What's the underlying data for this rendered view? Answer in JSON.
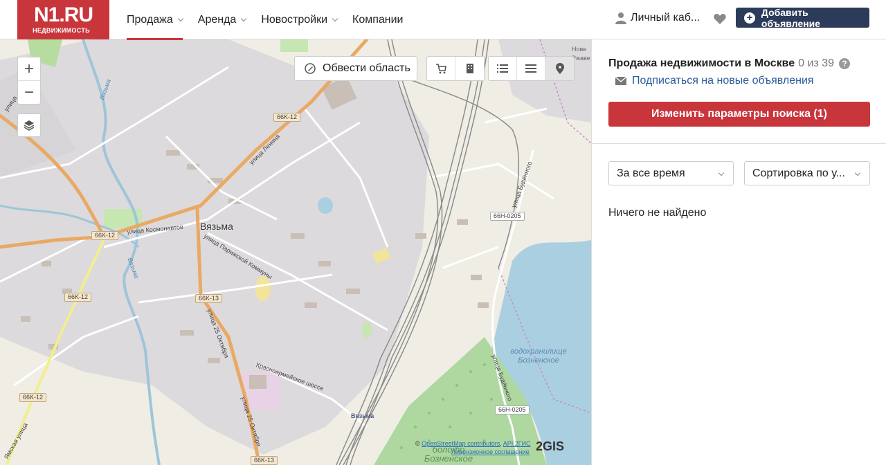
{
  "header": {
    "logo_main": "N1.RU",
    "logo_sub": "НЕДВИЖИМОСТЬ",
    "nav": [
      {
        "label": "Продажа",
        "active": true,
        "dropdown": true
      },
      {
        "label": "Аренда",
        "active": false,
        "dropdown": true
      },
      {
        "label": "Новостройки",
        "active": false,
        "dropdown": true
      },
      {
        "label": "Компании",
        "active": false,
        "dropdown": false
      }
    ],
    "cabinet_label": "Личный каб...",
    "add_button_label": "Добавить объявление",
    "colors": {
      "brand": "#c8363c",
      "add_button": "#2d3b5a"
    }
  },
  "map": {
    "area_button_label": "Обвести область",
    "zoom_in": "+",
    "zoom_out": "−",
    "icons": [
      "layers-icon",
      "cart-icon",
      "building-icon",
      "list-icon",
      "menu-icon",
      "map-pin-icon"
    ],
    "city_label": "Вязьма",
    "station_label": "Вязьма",
    "road_signs": [
      "66K-12",
      "66K-12",
      "66K-12",
      "66K-12",
      "66K-13",
      "66K-13",
      "66H-0205",
      "66H-0205"
    ],
    "street_labels": [
      "улица Ленина",
      "улица Космонавтов",
      "улица Парижской Коммуны",
      "улица 25 Октября",
      "улица 25 Октября",
      "Красноармейское шоссе",
      "улица Будённого",
      "улица Будённого",
      "Ямская улица",
      "улица",
      "Вязьма",
      "Вязьма"
    ],
    "water_label": "водохранилище Бозненское",
    "swamp_label": "болото Бозненское",
    "corner_text": "Нове Ржаве",
    "attribution": {
      "prefix": "©",
      "osm": "OpenStreetMap contributors",
      "api": "API 2ГИС",
      "license": "Лицензионное соглашение",
      "gis_logo": "2GIS"
    }
  },
  "panel": {
    "title": "Продажа недвижимости в Москве",
    "count": "0 из 39",
    "help": "?",
    "subscribe_label": "Подписаться на новые объявления",
    "change_button_label": "Изменить параметры поиска (1)",
    "period_select": "За все время",
    "sort_select": "Сортировка по у...",
    "empty_text": "Ничего не найдено"
  }
}
